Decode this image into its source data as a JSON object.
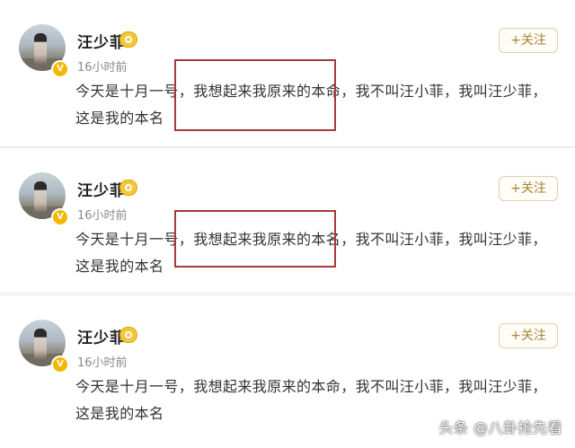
{
  "posts": [
    {
      "username": "汪少菲",
      "time": "16小时前",
      "follow_label": "+关注",
      "text": "今天是十月一号，我想起来我原来的本命，我不叫汪小菲，我叫汪少菲，这是我的本名",
      "highlighted_phrase": "我想起来我原来的本命"
    },
    {
      "username": "汪少菲",
      "time": "16小时前",
      "follow_label": "+关注",
      "text": "今天是十月一号，我想起来我原来的本名，我不叫汪小菲，我叫汪少菲，这是我的本名",
      "highlighted_phrase": "我想起来我原来的本名"
    },
    {
      "username": "汪少菲",
      "time": "16小时前",
      "follow_label": "+关注",
      "text": "今天是十月一号，我想起来我原来的本命，我不叫汪小菲，我叫汪少菲，这是我的本名"
    }
  ],
  "watermark": "头条 @八卦抢先看",
  "colors": {
    "highlight_box": "#a53a3a",
    "verified_badge": "#f5b800",
    "follow_text": "#a5823a"
  },
  "icons": {
    "verified": "verified-badge-icon",
    "member": "member-crown-icon"
  }
}
